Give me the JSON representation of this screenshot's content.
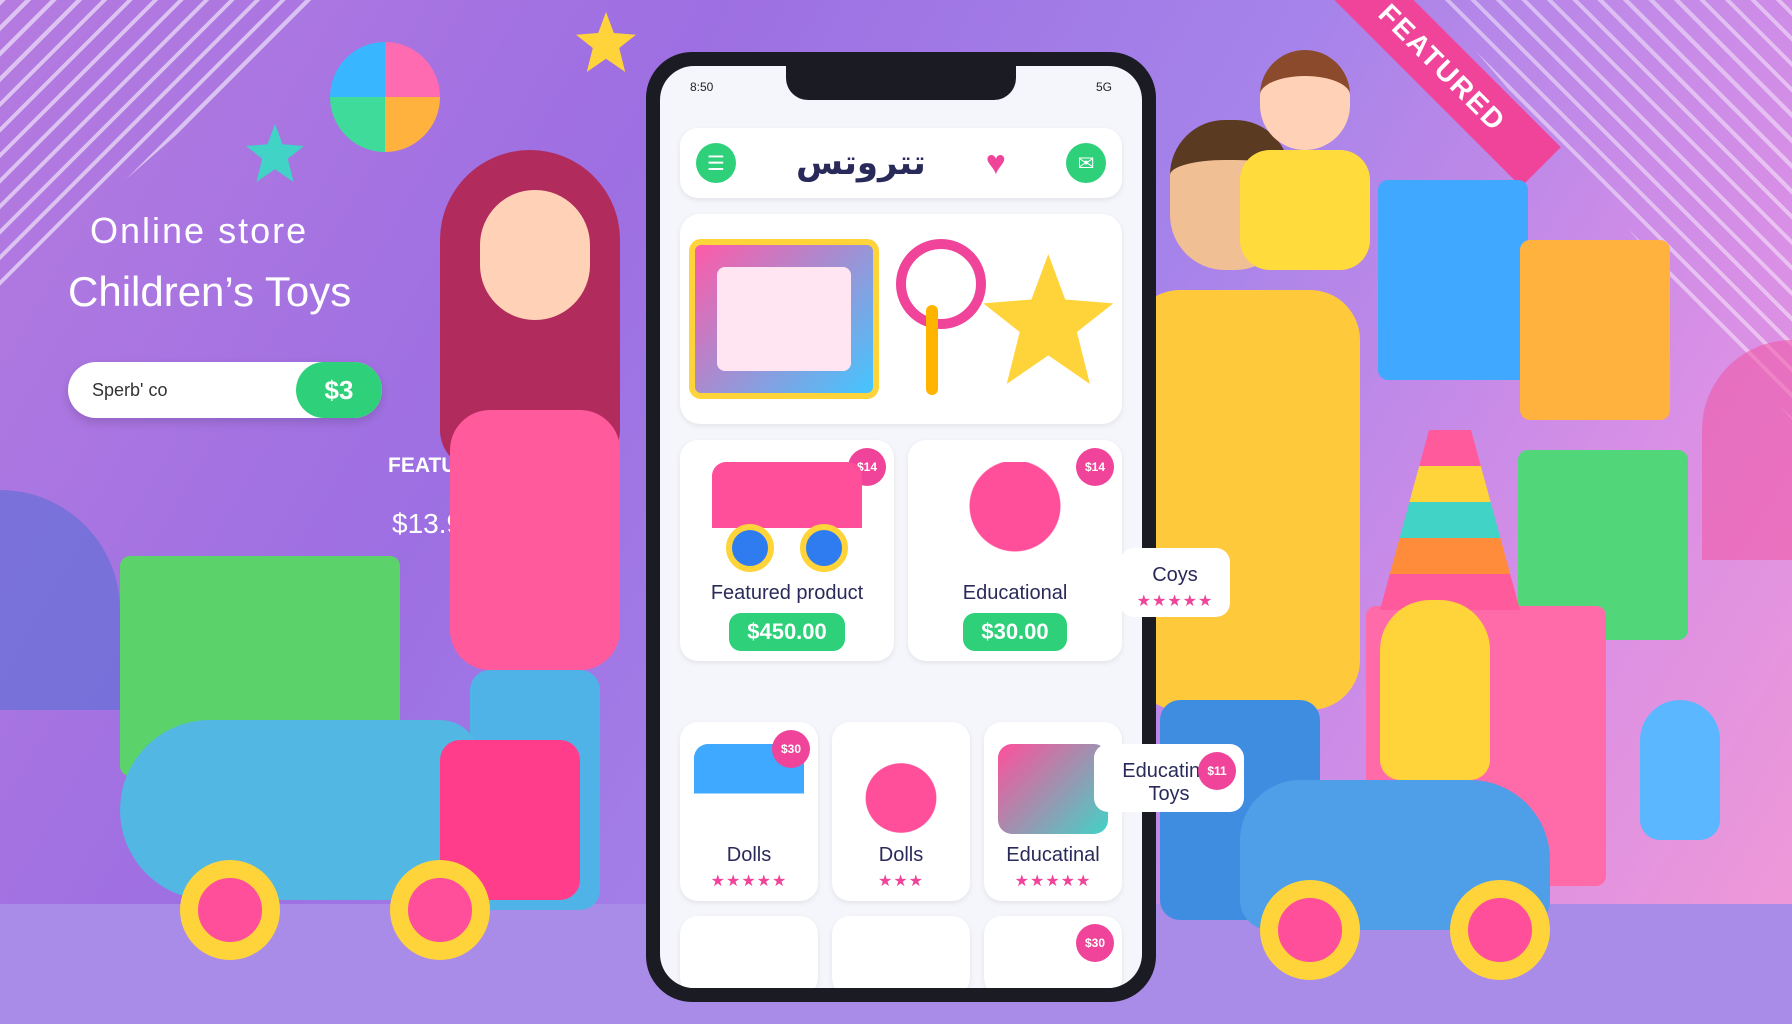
{
  "hero": {
    "store_label": "Online store",
    "store_title": "Children’s Toys",
    "search_placeholder": "Sperb' co",
    "search_button": "$3",
    "featured_label": "FEATURED",
    "featured_price": "$13.90",
    "ribbon_text": "FEATURED"
  },
  "app": {
    "status_left": "8:50",
    "status_right": "5G",
    "title": "تتروتس",
    "menu_icon": "menu-icon",
    "heart_icon": "heart-icon",
    "chat_icon": "chat-icon"
  },
  "products_row1": [
    {
      "name": "Featured product",
      "price": "$450.00",
      "badge": "$14"
    },
    {
      "name": "Educational",
      "price": "$30.00",
      "badge": "$14"
    }
  ],
  "side_item": {
    "name": "Coys",
    "stars": "★★★★★"
  },
  "products_row2": [
    {
      "name": "Dolls",
      "stars": "★★★★★",
      "badge": "$30"
    },
    {
      "name": "Dolls",
      "stars": "★★★",
      "badge": ""
    },
    {
      "name": "Educatinal",
      "stars": "★★★★★",
      "badge": ""
    }
  ],
  "side_item2": {
    "name": "Educatinal Toys",
    "badge": "$11"
  },
  "products_row3_badge": "$30",
  "colors": {
    "accent_green": "#2fd07a",
    "accent_pink": "#f0449a",
    "background_purple": "#a583ea"
  }
}
